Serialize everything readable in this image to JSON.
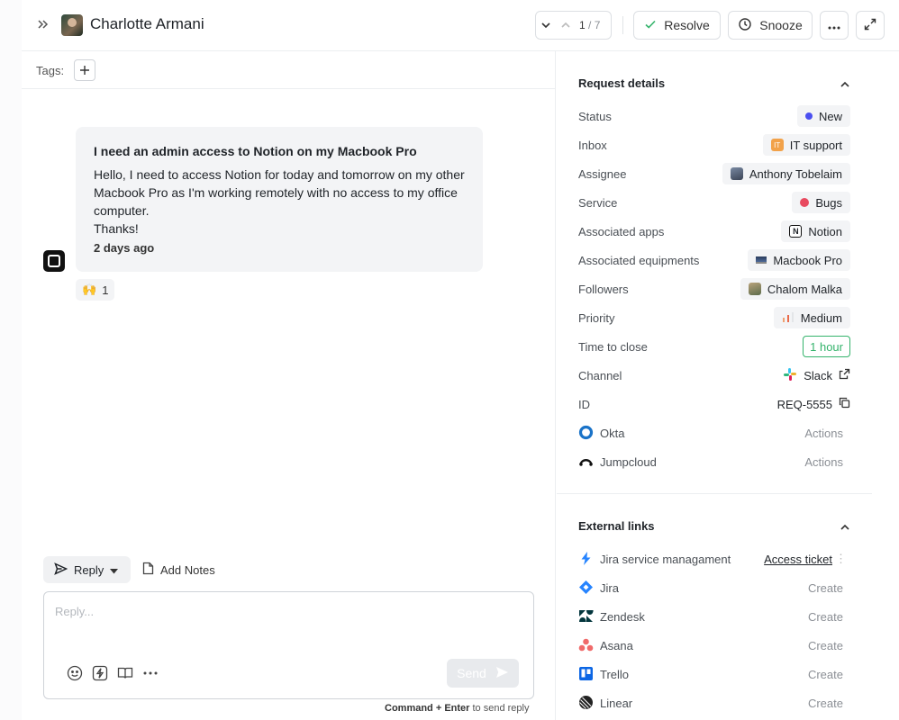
{
  "header": {
    "user_name": "Charlotte Armani",
    "nav_current": "1",
    "nav_total": "/ 7",
    "resolve_label": "Resolve",
    "snooze_label": "Snooze"
  },
  "tags": {
    "label": "Tags:"
  },
  "message": {
    "title": "I need an admin access to Notion on my Macbook Pro",
    "body": "Hello, I need to access Notion for today and tomorrow on my other Macbook Pro as I'm working remotely with no access to my office computer.\nThanks!",
    "time": "2 days ago",
    "reaction_emoji": "🙌",
    "reaction_count": "1"
  },
  "composer": {
    "reply_tab": "Reply",
    "notes_tab": "Add Notes",
    "placeholder": "Reply...",
    "send_label": "Send",
    "hint_keys": "Command + Enter",
    "hint_text": " to send reply"
  },
  "request_details": {
    "title": "Request details",
    "rows": [
      {
        "label": "Status",
        "value": "New"
      },
      {
        "label": "Inbox",
        "value": "IT support",
        "badge": "IT"
      },
      {
        "label": "Assignee",
        "value": "Anthony Tobelaim"
      },
      {
        "label": "Service",
        "value": "Bugs"
      },
      {
        "label": "Associated apps",
        "value": "Notion"
      },
      {
        "label": "Associated equipments",
        "value": "Macbook Pro"
      },
      {
        "label": "Followers",
        "value": "Chalom Malka"
      },
      {
        "label": "Priority",
        "value": "Medium"
      },
      {
        "label": "Time to close",
        "value": "1 hour"
      },
      {
        "label": "Channel",
        "value": "Slack"
      },
      {
        "label": "ID",
        "value": "REQ-5555"
      }
    ],
    "integrations": [
      {
        "name": "Okta",
        "action": "Actions"
      },
      {
        "name": "Jumpcloud",
        "action": "Actions"
      }
    ]
  },
  "external_links": {
    "title": "External links",
    "items": [
      {
        "name": "Jira service managament",
        "action": "Access ticket"
      },
      {
        "name": "Jira",
        "action": "Create"
      },
      {
        "name": "Zendesk",
        "action": "Create"
      },
      {
        "name": "Asana",
        "action": "Create"
      },
      {
        "name": "Trello",
        "action": "Create"
      },
      {
        "name": "Linear",
        "action": "Create"
      }
    ]
  },
  "colors": {
    "status_new": "#4b4ff0",
    "time_to_close": "#34b36b",
    "inbox_badge": "#f2a24a",
    "bugs": "#e84a5f"
  }
}
